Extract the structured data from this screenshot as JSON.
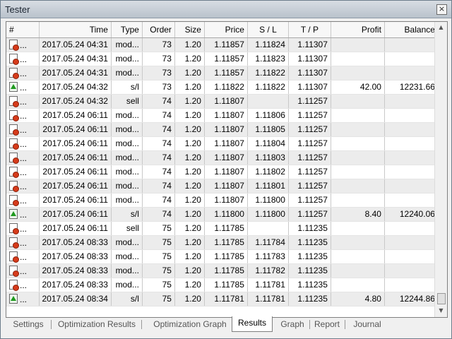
{
  "window": {
    "title": "Tester",
    "close_glyph": "×"
  },
  "columns": [
    "#",
    "Time",
    "Type",
    "Order",
    "Size",
    "Price",
    "S / L",
    "T / P",
    "Profit",
    "Balance"
  ],
  "rows": [
    {
      "icon": "modify-order-icon",
      "num": "...",
      "time": "2017.05.24 04:31",
      "type": "mod...",
      "order": "73",
      "size": "1.20",
      "price": "1.11857",
      "sl": "1.11824",
      "tp": "1.11307",
      "profit": "",
      "balance": ""
    },
    {
      "icon": "modify-order-icon",
      "num": "...",
      "time": "2017.05.24 04:31",
      "type": "mod...",
      "order": "73",
      "size": "1.20",
      "price": "1.11857",
      "sl": "1.11823",
      "tp": "1.11307",
      "profit": "",
      "balance": ""
    },
    {
      "icon": "modify-order-icon",
      "num": "...",
      "time": "2017.05.24 04:31",
      "type": "mod...",
      "order": "73",
      "size": "1.20",
      "price": "1.11857",
      "sl": "1.11822",
      "tp": "1.11307",
      "profit": "",
      "balance": ""
    },
    {
      "icon": "stop-loss-icon",
      "num": "...",
      "time": "2017.05.24 04:32",
      "type": "s/l",
      "order": "73",
      "size": "1.20",
      "price": "1.11822",
      "sl": "1.11822",
      "tp": "1.11307",
      "profit": "42.00",
      "balance": "12231.66"
    },
    {
      "icon": "modify-order-icon",
      "num": "...",
      "time": "2017.05.24 04:32",
      "type": "sell",
      "order": "74",
      "size": "1.20",
      "price": "1.11807",
      "sl": "",
      "tp": "1.11257",
      "profit": "",
      "balance": ""
    },
    {
      "icon": "modify-order-icon",
      "num": "...",
      "time": "2017.05.24 06:11",
      "type": "mod...",
      "order": "74",
      "size": "1.20",
      "price": "1.11807",
      "sl": "1.11806",
      "tp": "1.11257",
      "profit": "",
      "balance": ""
    },
    {
      "icon": "modify-order-icon",
      "num": "...",
      "time": "2017.05.24 06:11",
      "type": "mod...",
      "order": "74",
      "size": "1.20",
      "price": "1.11807",
      "sl": "1.11805",
      "tp": "1.11257",
      "profit": "",
      "balance": ""
    },
    {
      "icon": "modify-order-icon",
      "num": "...",
      "time": "2017.05.24 06:11",
      "type": "mod...",
      "order": "74",
      "size": "1.20",
      "price": "1.11807",
      "sl": "1.11804",
      "tp": "1.11257",
      "profit": "",
      "balance": ""
    },
    {
      "icon": "modify-order-icon",
      "num": "...",
      "time": "2017.05.24 06:11",
      "type": "mod...",
      "order": "74",
      "size": "1.20",
      "price": "1.11807",
      "sl": "1.11803",
      "tp": "1.11257",
      "profit": "",
      "balance": ""
    },
    {
      "icon": "modify-order-icon",
      "num": "...",
      "time": "2017.05.24 06:11",
      "type": "mod...",
      "order": "74",
      "size": "1.20",
      "price": "1.11807",
      "sl": "1.11802",
      "tp": "1.11257",
      "profit": "",
      "balance": ""
    },
    {
      "icon": "modify-order-icon",
      "num": "...",
      "time": "2017.05.24 06:11",
      "type": "mod...",
      "order": "74",
      "size": "1.20",
      "price": "1.11807",
      "sl": "1.11801",
      "tp": "1.11257",
      "profit": "",
      "balance": ""
    },
    {
      "icon": "modify-order-icon",
      "num": "...",
      "time": "2017.05.24 06:11",
      "type": "mod...",
      "order": "74",
      "size": "1.20",
      "price": "1.11807",
      "sl": "1.11800",
      "tp": "1.11257",
      "profit": "",
      "balance": ""
    },
    {
      "icon": "stop-loss-icon",
      "num": "...",
      "time": "2017.05.24 06:11",
      "type": "s/l",
      "order": "74",
      "size": "1.20",
      "price": "1.11800",
      "sl": "1.11800",
      "tp": "1.11257",
      "profit": "8.40",
      "balance": "12240.06"
    },
    {
      "icon": "modify-order-icon",
      "num": "...",
      "time": "2017.05.24 06:11",
      "type": "sell",
      "order": "75",
      "size": "1.20",
      "price": "1.11785",
      "sl": "",
      "tp": "1.11235",
      "profit": "",
      "balance": ""
    },
    {
      "icon": "modify-order-icon",
      "num": "...",
      "time": "2017.05.24 08:33",
      "type": "mod...",
      "order": "75",
      "size": "1.20",
      "price": "1.11785",
      "sl": "1.11784",
      "tp": "1.11235",
      "profit": "",
      "balance": ""
    },
    {
      "icon": "modify-order-icon",
      "num": "...",
      "time": "2017.05.24 08:33",
      "type": "mod...",
      "order": "75",
      "size": "1.20",
      "price": "1.11785",
      "sl": "1.11783",
      "tp": "1.11235",
      "profit": "",
      "balance": ""
    },
    {
      "icon": "modify-order-icon",
      "num": "...",
      "time": "2017.05.24 08:33",
      "type": "mod...",
      "order": "75",
      "size": "1.20",
      "price": "1.11785",
      "sl": "1.11782",
      "tp": "1.11235",
      "profit": "",
      "balance": ""
    },
    {
      "icon": "modify-order-icon",
      "num": "...",
      "time": "2017.05.24 08:33",
      "type": "mod...",
      "order": "75",
      "size": "1.20",
      "price": "1.11785",
      "sl": "1.11781",
      "tp": "1.11235",
      "profit": "",
      "balance": ""
    },
    {
      "icon": "stop-loss-icon",
      "num": "...",
      "time": "2017.05.24 08:34",
      "type": "s/l",
      "order": "75",
      "size": "1.20",
      "price": "1.11781",
      "sl": "1.11781",
      "tp": "1.11235",
      "profit": "4.80",
      "balance": "12244.86"
    }
  ],
  "scrollbar": {
    "up_glyph": "▲",
    "down_glyph": "▼"
  },
  "tabs": [
    {
      "label": "Settings",
      "active": false
    },
    {
      "label": "Optimization Results",
      "active": false
    },
    {
      "label": "Optimization Graph",
      "active": false
    },
    {
      "label": "Results",
      "active": true
    },
    {
      "label": "Graph",
      "active": false
    },
    {
      "label": "Report",
      "active": false
    },
    {
      "label": "Journal",
      "active": false
    }
  ]
}
